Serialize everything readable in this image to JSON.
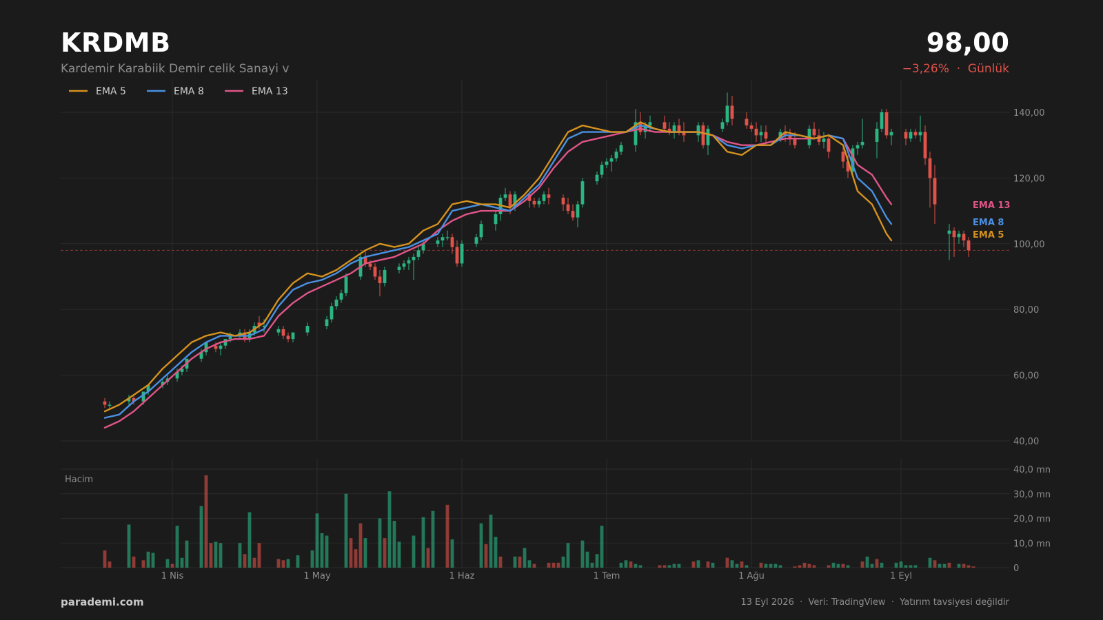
{
  "header": {
    "ticker": "KRDMB",
    "company": "Kardemir Karabiik Demir celik Sanayi v",
    "price": "98,00",
    "change": "−3,26%",
    "separator": "·",
    "period": "Günlük"
  },
  "footer": {
    "brand": "parademi.com",
    "date": "13 Eyl 2026",
    "source": "Veri: TradingView",
    "disclaimer": "Yatırım tavsiyesi değildir"
  },
  "colors": {
    "background": "#1b1b1b",
    "up": "#2bb583",
    "down": "#e0524a",
    "ema5": "#d4921e",
    "ema8": "#4a90e2",
    "ema13": "#e05588",
    "grid": "#2b2b2b",
    "last_price_line": "#e0524a"
  },
  "chart_data": {
    "type": "candlestick",
    "price_axis": {
      "min": 40,
      "max": 140,
      "ticks": [
        "40,00",
        "60,00",
        "80,00",
        "100,00",
        "120,00",
        "140,00"
      ]
    },
    "volume_axis": {
      "min": 0,
      "max": 40,
      "unit": "mn",
      "label": "Hacim",
      "ticks": [
        "0",
        "10,0 mn",
        "20,0 mn",
        "30,0 mn",
        "40,0 mn"
      ]
    },
    "x_ticks": [
      "1 Nis",
      "1 May",
      "1 Haz",
      "1 Tem",
      "1 Ağu",
      "1 Eyl"
    ],
    "last_price": 98.0,
    "legend": [
      "EMA 5",
      "EMA 8",
      "EMA 13"
    ],
    "end_labels": [
      "EMA 13",
      "EMA 8",
      "EMA 5"
    ],
    "ema": {
      "ema5": [
        [
          0,
          49
        ],
        [
          3,
          51
        ],
        [
          6,
          54
        ],
        [
          9,
          57
        ],
        [
          12,
          62
        ],
        [
          15,
          66
        ],
        [
          18,
          70
        ],
        [
          21,
          72
        ],
        [
          24,
          73
        ],
        [
          27,
          72
        ],
        [
          30,
          73
        ],
        [
          33,
          76
        ],
        [
          36,
          83
        ],
        [
          39,
          88
        ],
        [
          42,
          91
        ],
        [
          45,
          90
        ],
        [
          48,
          92
        ],
        [
          51,
          95
        ],
        [
          54,
          98
        ],
        [
          57,
          100
        ],
        [
          60,
          99
        ],
        [
          63,
          100
        ],
        [
          66,
          104
        ],
        [
          69,
          106
        ],
        [
          72,
          112
        ],
        [
          75,
          113
        ],
        [
          78,
          112
        ],
        [
          81,
          112
        ],
        [
          84,
          111
        ],
        [
          87,
          115
        ],
        [
          90,
          120
        ],
        [
          93,
          127
        ],
        [
          96,
          134
        ],
        [
          99,
          136
        ],
        [
          102,
          135
        ],
        [
          105,
          134
        ],
        [
          108,
          134
        ],
        [
          111,
          137
        ],
        [
          114,
          135
        ],
        [
          117,
          134
        ],
        [
          120,
          134
        ],
        [
          123,
          134
        ],
        [
          126,
          133
        ],
        [
          129,
          128
        ],
        [
          132,
          127
        ],
        [
          135,
          130
        ],
        [
          138,
          130
        ],
        [
          141,
          134
        ],
        [
          144,
          133
        ],
        [
          147,
          132
        ],
        [
          150,
          133
        ],
        [
          153,
          130
        ],
        [
          156,
          116
        ],
        [
          159,
          112
        ],
        [
          162,
          103
        ],
        [
          163,
          101
        ]
      ],
      "ema8": [
        [
          0,
          47
        ],
        [
          3,
          48
        ],
        [
          6,
          52
        ],
        [
          9,
          55
        ],
        [
          12,
          59
        ],
        [
          15,
          63
        ],
        [
          18,
          67
        ],
        [
          21,
          70
        ],
        [
          24,
          72
        ],
        [
          27,
          72
        ],
        [
          30,
          72
        ],
        [
          33,
          74
        ],
        [
          36,
          81
        ],
        [
          39,
          86
        ],
        [
          42,
          88
        ],
        [
          45,
          89
        ],
        [
          48,
          91
        ],
        [
          51,
          94
        ],
        [
          54,
          96
        ],
        [
          57,
          97
        ],
        [
          60,
          98
        ],
        [
          63,
          99
        ],
        [
          66,
          101
        ],
        [
          69,
          103
        ],
        [
          72,
          110
        ],
        [
          75,
          111
        ],
        [
          78,
          112
        ],
        [
          81,
          111
        ],
        [
          84,
          110
        ],
        [
          87,
          114
        ],
        [
          90,
          118
        ],
        [
          93,
          125
        ],
        [
          96,
          132
        ],
        [
          99,
          134
        ],
        [
          102,
          134
        ],
        [
          105,
          134
        ],
        [
          108,
          134
        ],
        [
          111,
          136
        ],
        [
          114,
          135
        ],
        [
          117,
          134
        ],
        [
          120,
          134
        ],
        [
          123,
          134
        ],
        [
          126,
          133
        ],
        [
          129,
          130
        ],
        [
          132,
          129
        ],
        [
          135,
          130
        ],
        [
          138,
          130
        ],
        [
          141,
          133
        ],
        [
          144,
          133
        ],
        [
          147,
          132
        ],
        [
          150,
          133
        ],
        [
          153,
          132
        ],
        [
          156,
          120
        ],
        [
          159,
          116
        ],
        [
          162,
          108
        ],
        [
          163,
          106
        ]
      ],
      "ema13": [
        [
          0,
          44
        ],
        [
          3,
          46
        ],
        [
          6,
          49
        ],
        [
          9,
          53
        ],
        [
          12,
          57
        ],
        [
          15,
          61
        ],
        [
          18,
          65
        ],
        [
          21,
          68
        ],
        [
          24,
          70
        ],
        [
          27,
          71
        ],
        [
          30,
          71
        ],
        [
          33,
          72
        ],
        [
          36,
          78
        ],
        [
          39,
          82
        ],
        [
          42,
          85
        ],
        [
          45,
          87
        ],
        [
          48,
          89
        ],
        [
          51,
          91
        ],
        [
          54,
          94
        ],
        [
          57,
          95
        ],
        [
          60,
          96
        ],
        [
          63,
          98
        ],
        [
          66,
          100
        ],
        [
          69,
          104
        ],
        [
          72,
          107
        ],
        [
          75,
          109
        ],
        [
          78,
          110
        ],
        [
          81,
          110
        ],
        [
          84,
          110
        ],
        [
          87,
          113
        ],
        [
          90,
          117
        ],
        [
          93,
          123
        ],
        [
          96,
          128
        ],
        [
          99,
          131
        ],
        [
          102,
          132
        ],
        [
          105,
          133
        ],
        [
          108,
          134
        ],
        [
          111,
          135
        ],
        [
          114,
          134
        ],
        [
          117,
          134
        ],
        [
          120,
          134
        ],
        [
          123,
          134
        ],
        [
          126,
          133
        ],
        [
          129,
          131
        ],
        [
          132,
          130
        ],
        [
          135,
          130
        ],
        [
          138,
          131
        ],
        [
          141,
          132
        ],
        [
          144,
          132
        ],
        [
          147,
          132
        ],
        [
          150,
          133
        ],
        [
          153,
          132
        ],
        [
          156,
          124
        ],
        [
          159,
          121
        ],
        [
          162,
          114
        ],
        [
          163,
          112
        ]
      ]
    },
    "candles_compact": "0:52,53,50,51;1:51,52,50,51;5:52,54,51,53;6:53,54,51,52;8:52,55,51,55;9:55,57,54,57;12:57,59,56,58;13:58,60,57,59;15:59,62,58,61;16:61,63,60,62;17:62,65,61,65;20:65,68,64,67;21:67,69,66,70;23:69,70,67,68;24:68,70,66,69;25:69,71,68,71;26:71,73,70,72;28:72,74,71,73;29:73,74,70,71;30:71,74,70,73;31:73,76,72,75;32:76,78,74,75;33:75,77,73,75;36:73,75,72,74;37:74,75,71,72;38:72,73,70,71;39:71,73,70,73;42:73,76,72,75;46:75,78,74,77;47:77,82,76,81;48:81,84,80,83;49:83,86,82,85;50:85,91,84,90;53:90,97,89,96;54:96,98,93,94;55:94,95,92,93;56:93,94,89,90;57:90,92,84,88;58:88,93,87,92;61:92,94,91,93;62:93,95,92,94;63:94,96,92,95;64:95,97,89,96;65:96,99,95,98;66:98,101,97,100;69:100,102,99,101;70:101,103,99,102;71:102,104,101,102;72:102,103,97,99;73:99,101,93,94;74:94,101,93,100;77:100,103,99,102;78:102,107,101,106;81:106,110,104,109;82:109,115,107,114;83:114,117,113,115;84:115,116,109,111;85:111,116,110,115;88:115,116,111,113;89:113,114,111,112;90:112,114,111,113;91:113,116,112,115;92:115,117,112,114;95:114,115,110,112;96:112,114,109,110;97:110,112,107,108;98:108,113,105,112;99:112,120,111,119;102:119,122,118,121;103:121,125,120,124;104:124,126,123,125;105:125,127,122,126;106:126,129,125,128;107:128,131,127,130;110:130,141,128,137;111:137,140,133,134;112:134,137,132,136;113:136,139,134,137;116:137,139,134,135;117:135,137,133,134;118:134,137,132,136;119:136,138,133,134;120:134,137,131,133;123:133,137,131,136;124:136,137,129,130;125:130,136,127,135;128:135,138,134,137;129:137,146,136,142;130:142,145,136,138;133:138,140,135,136;134:136,137,134,135;135:135,137,131,133;136:133,136,131,134;137:134,136,130,132;140:132,135,131,134;141:134,136,131,133;142:133,135,130,132;143:132,134,129,130;146:130,136,129,135;147:135,137,132,133;148:133,135,130,131;149:131,134,129,132;150:132,133,126,128;153:128,130,123,125;154:125,127,120,122;155:122,130,121,129;156:129,131,127,130;157:130,138,129,131;160:131,137,126,135;161:135,141,134,140;162:140,141,132,133;163:133,135,130,134;166:134,135,130,132;167:132,135,131,134;168:134,135,132,133;169:133,139,131,134;170:134,136,124,126;171:126,128,111,120;172:120,124,106,112;175:103,106,95,104;176:104,105,96,102;177:102,104,100,103;178:103,104,99,101;179:101,102,96,98",
    "volume_compact": "0:7,d;1:2.5,d;5:17.5,u;6:4.5,d;8:3,d;9:6.5,u;10:6,u;13:3.5,u;14:1.5,d;15:17,u;16:4,u;17:11,u;20:25,u;21:37.5,d;22:10,d;23:10.5,u;24:10,u;28:10,u;29:5.5,d;30:22.5,u;31:4,d;32:10,d;36:3.5,d;37:3,d;38:3.5,u;40:5,u;43:7,u;44:22,u;45:14,u;46:13,u;50:30,u;51:12,d;52:7.5,d;53:18,d;54:12,u;57:20,u;58:12,d;59:31,u;60:19,u;61:10.5,u;64:13,u;66:20.5,u;67:8,d;68:23,u;71:25.5,d;72:11.5,u;78:18,u;79:9.5,d;80:21.5,u;81:12.5,u;82:4.5,d;85:4.5,u;86:4.5,d;87:8,u;88:3,u;89:1.5,d;92:2,d;93:2,d;94:2,d;95:4.5,u;96:10,u;99:11,u;100:6.5,u;101:2,u;102:5.5,u;103:17,u;107:2,u;108:3,u;109:2.5,d;110:1.5,u;111:1,u;115:1,d;116:1,d;117:1,u;118:1.5,u;119:1.5,u;122:2.5,d;123:3,u;125:2.5,d;126:2,u;129:4,d;130:3,u;131:1.5,u;132:2.5,d;133:1,u;136:2,d;137:1.5,u;138:1.5,u;139:1.5,u;140:1,u;143:0.5,d;144:1,d;145:2,d;146:1.5,d;147:1,d;150:1,d;151:2,u;152:1.5,u;153:1.5,d;154:1,u;157:2.5,d;158:4.5,u;159:1.5,u;160:3.5,d;161:2,u;164:2,u;165:2.5,u;166:1,u;167:1,u;168:1,u;171:4,u;172:3,d;173:1.5,u;174:1.5,u;175:2,d;177:1.5,u;178:1.5,d;179:1,d;180:0.5,d"
  }
}
